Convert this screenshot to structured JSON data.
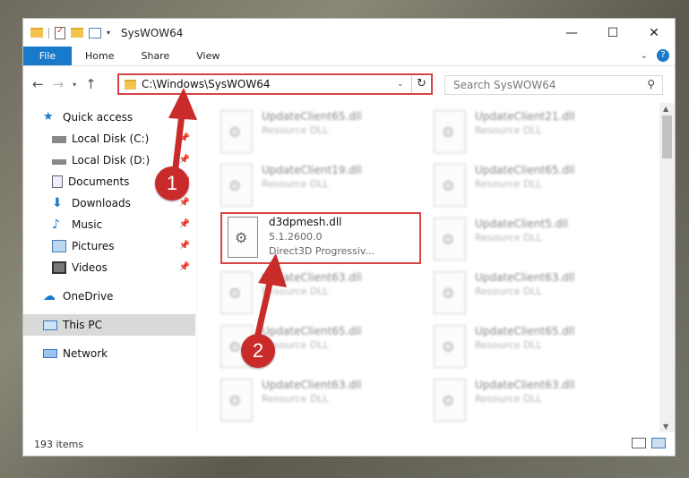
{
  "window": {
    "title": "SysWOW64",
    "controls": {
      "minimize": "—",
      "maximize": "☐",
      "close": "✕"
    }
  },
  "ribbon": {
    "file_tab": "File",
    "tabs": [
      "Home",
      "Share",
      "View"
    ],
    "expand": "⌄",
    "help": "?"
  },
  "nav": {
    "back": "←",
    "forward": "→",
    "recent": "▾",
    "up": "↑"
  },
  "address": {
    "path": "C:\\Windows\\SysWOW64",
    "dropdown": "⌄",
    "refresh": "↻"
  },
  "search": {
    "placeholder": "Search SysWOW64",
    "icon": "search-icon"
  },
  "sidebar": {
    "items": [
      {
        "label": "Quick access",
        "icon": "star-icon",
        "pinned": false
      },
      {
        "label": "Local Disk (C:)",
        "icon": "drive-icon",
        "pinned": true
      },
      {
        "label": "Local Disk (D:)",
        "icon": "drive-icon",
        "pinned": true
      },
      {
        "label": "Documents",
        "icon": "documents-icon",
        "pinned": true
      },
      {
        "label": "Downloads",
        "icon": "download-icon",
        "pinned": true
      },
      {
        "label": "Music",
        "icon": "music-icon",
        "pinned": true
      },
      {
        "label": "Pictures",
        "icon": "pictures-icon",
        "pinned": true
      },
      {
        "label": "Videos",
        "icon": "videos-icon",
        "pinned": true
      },
      {
        "label": "OneDrive",
        "icon": "cloud-icon",
        "pinned": false
      },
      {
        "label": "This PC",
        "icon": "computer-icon",
        "pinned": false
      },
      {
        "label": "Network",
        "icon": "network-icon",
        "pinned": false
      }
    ]
  },
  "files": {
    "highlighted": {
      "name": "d3dpmesh.dll",
      "version": "5.1.2600.0",
      "description": "Direct3D Progressiv..."
    },
    "blurred": [
      {
        "name": "UpdateClient65.dll",
        "type": "Resource DLL"
      },
      {
        "name": "UpdateClient21.dll",
        "type": "Resource DLL"
      },
      {
        "name": "UpdateClient19.dll",
        "type": "Resource DLL"
      },
      {
        "name": "UpdateClient65.dll",
        "type": "Resource DLL"
      },
      {
        "name": "UpdateClient5.dll",
        "type": "Resource DLL"
      },
      {
        "name": "UpdateClient63.dll",
        "type": "Resource DLL"
      },
      {
        "name": "UpdateClient63.dll",
        "type": "Resource DLL"
      },
      {
        "name": "UpdateClient65.dll",
        "type": "Resource DLL"
      },
      {
        "name": "UpdateClient65.dll",
        "type": "Resource DLL"
      },
      {
        "name": "UpdateClient63.dll",
        "type": "Resource DLL"
      },
      {
        "name": "UpdateClient63.dll",
        "type": "Resource DLL"
      }
    ]
  },
  "status": {
    "count": "193 items"
  },
  "annotations": {
    "step1": "1",
    "step2": "2",
    "color": "#c92a2a"
  },
  "colors": {
    "accent": "#1979ca",
    "highlight": "#d64545",
    "selected": "#d9d9d9"
  }
}
